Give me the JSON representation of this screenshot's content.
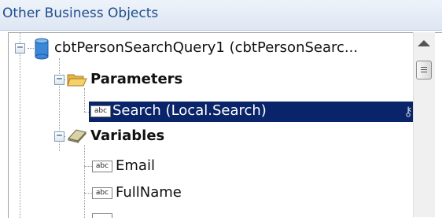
{
  "panel": {
    "title": "Other Business Objects"
  },
  "tree": {
    "root": {
      "label": "cbtPersonSearchQuery1 (cbtPersonSearc...",
      "expander": "−",
      "icon": "database-icon"
    },
    "parameters": {
      "label": "Parameters",
      "expander": "−",
      "icon": "folder-open-icon",
      "items": [
        {
          "label": "Search (Local.Search)",
          "icon_text": "abc",
          "selected": true
        }
      ]
    },
    "variables": {
      "label": "Variables",
      "expander": "−",
      "icon": "variables-icon",
      "items": [
        {
          "label": "Email",
          "icon_text": "abc"
        },
        {
          "label": "FullName",
          "icon_text": "abc"
        }
      ]
    }
  },
  "colors": {
    "selection": "#0a246a",
    "header_text": "#1f4e8c"
  }
}
